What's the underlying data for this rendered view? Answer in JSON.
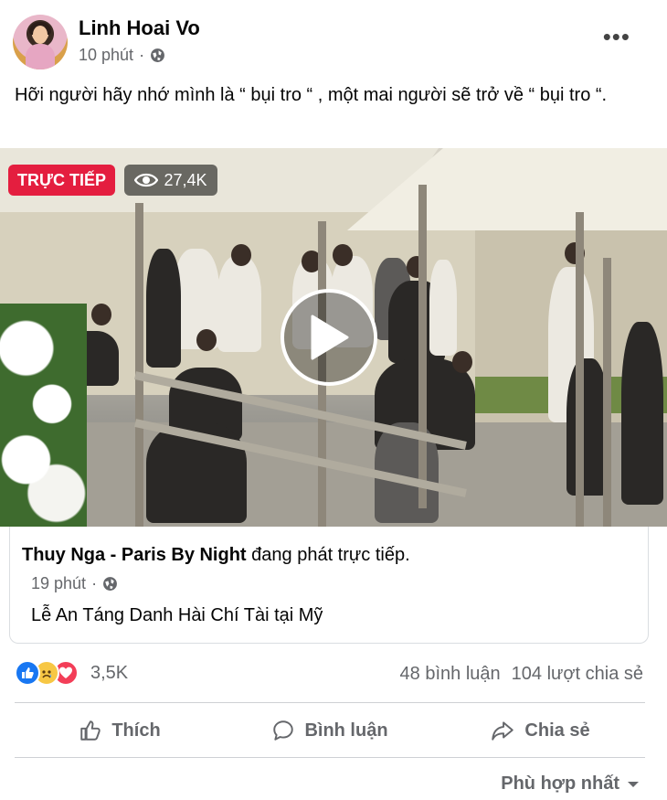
{
  "post": {
    "author": "Linh Hoai Vo",
    "time": "10 phút",
    "separator": "·",
    "more": "•••",
    "caption": "Hỡi người hãy nhớ mình là “ bụi tro “ , một mai người sẽ trở về “ bụi tro “."
  },
  "video": {
    "live_label": "TRỰC TIẾP",
    "viewers": "27,4K"
  },
  "shared": {
    "page_name": "Thuy Nga - Paris By Night",
    "status": " đang phát trực tiếp.",
    "time": "19 phút",
    "separator": "·",
    "title": "Lễ An Táng Danh Hài Chí Tài tại Mỹ"
  },
  "engagement": {
    "reaction_count": "3,5K",
    "comments": "48 bình luận",
    "shares": "104 lượt chia sẻ"
  },
  "actions": {
    "like": "Thích",
    "comment": "Bình luận",
    "share": "Chia sẻ"
  },
  "sort": {
    "label": "Phù hợp nhất"
  },
  "colors": {
    "live_red": "#e41e3f",
    "like_blue": "#1877f2",
    "meta_grey": "#65676b"
  },
  "icons": [
    "globe-icon",
    "more-icon",
    "eye-icon",
    "play-icon",
    "like-reaction-icon",
    "sad-reaction-icon",
    "love-reaction-icon",
    "thumbs-up-icon",
    "comment-icon",
    "share-icon",
    "caret-down-icon"
  ]
}
